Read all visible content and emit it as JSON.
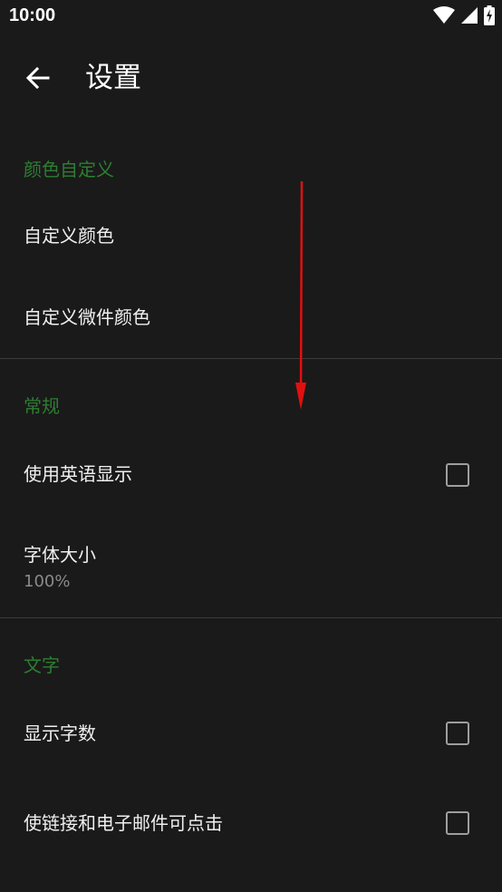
{
  "status_bar": {
    "time": "10:00",
    "icons": [
      "wifi-icon",
      "cell-signal-icon",
      "battery-charging-icon"
    ]
  },
  "app_bar": {
    "back_icon": "arrow-left-icon",
    "title": "设置"
  },
  "sections": {
    "color": {
      "header": "颜色自定义",
      "items": {
        "custom_color": {
          "title": "自定义颜色"
        },
        "widget_color": {
          "title": "自定义微件颜色"
        }
      }
    },
    "general": {
      "header": "常规",
      "items": {
        "english": {
          "title": "使用英语显示",
          "checked": false
        },
        "font_size": {
          "title": "字体大小",
          "summary": "100%"
        }
      }
    },
    "text": {
      "header": "文字",
      "items": {
        "word_count": {
          "title": "显示字数",
          "checked": false
        },
        "clickable_links": {
          "title": "使链接和电子邮件可点击",
          "checked": false
        }
      }
    }
  },
  "colors": {
    "background": "#1a1a1a",
    "section_header": "#2e7d32",
    "annotation_arrow": "#e01010"
  }
}
